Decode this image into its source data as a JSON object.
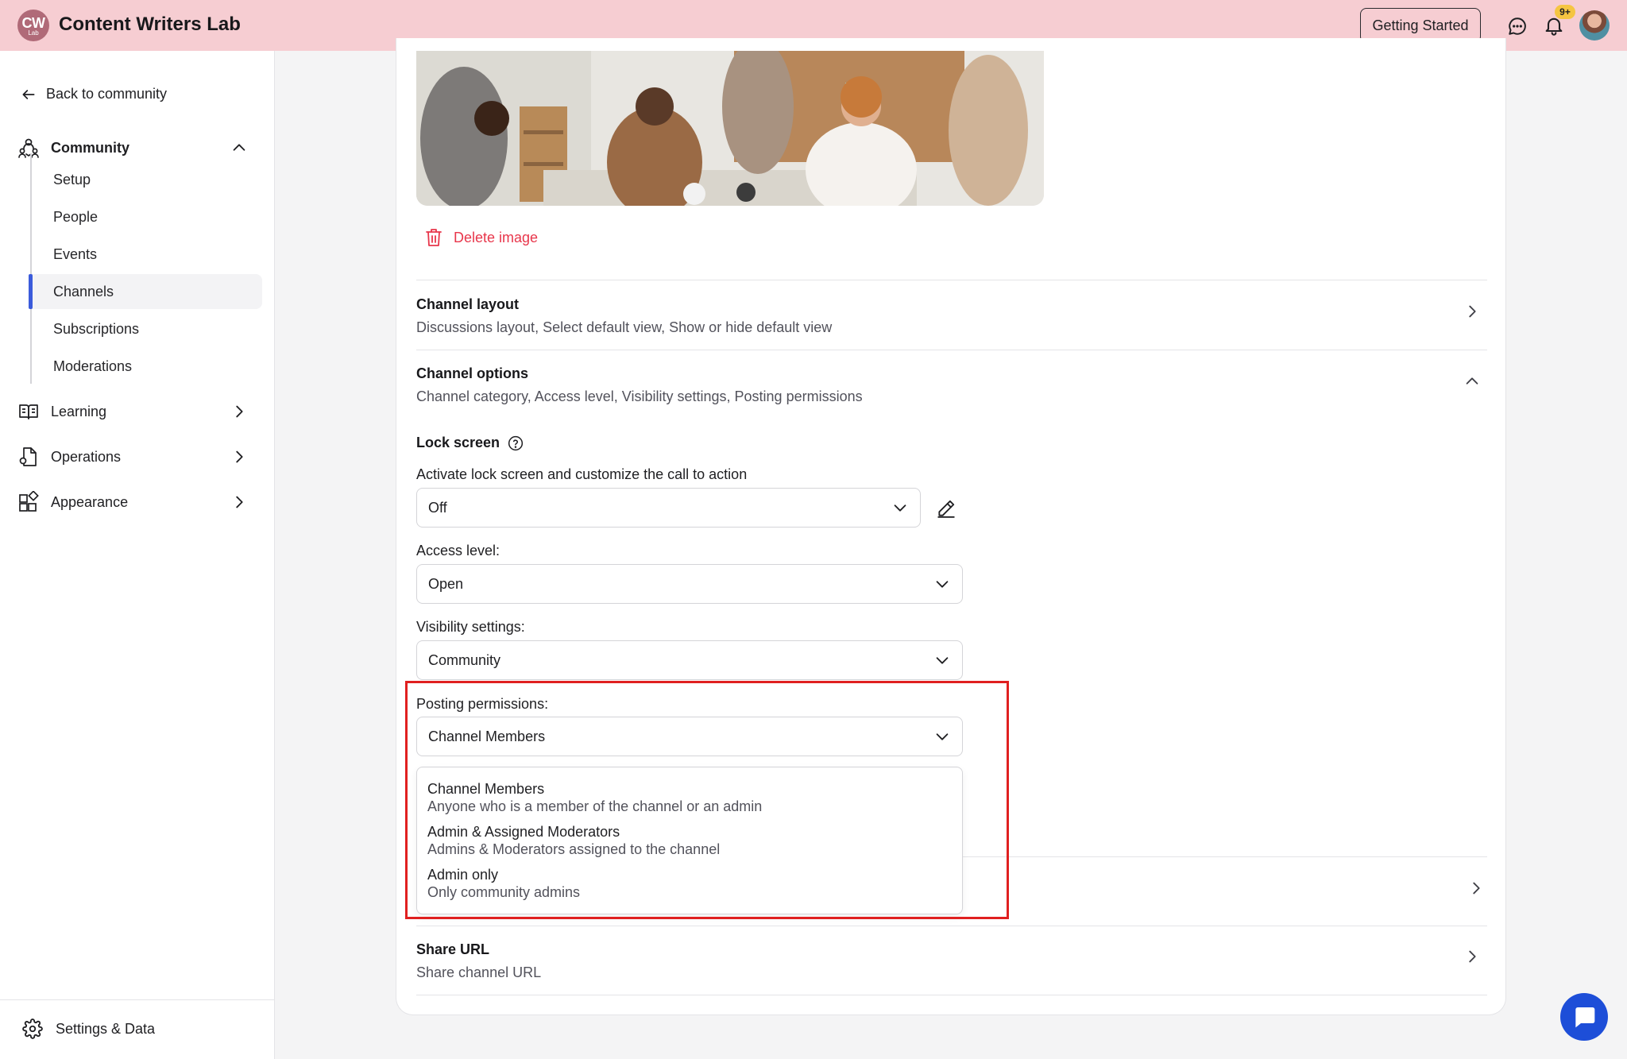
{
  "topbar": {
    "logo_top": "CW",
    "logo_bottom": "Lab",
    "app_title": "Content Writers Lab",
    "getting_started": "Getting Started",
    "notification_count": "9+"
  },
  "sidebar": {
    "back": "Back to community",
    "community": "Community",
    "sub_items": [
      "Setup",
      "People",
      "Events",
      "Channels",
      "Subscriptions",
      "Moderations"
    ],
    "active_sub_item": "Channels",
    "learning": "Learning",
    "operations": "Operations",
    "appearance": "Appearance",
    "settings": "Settings & Data"
  },
  "main": {
    "delete_image": "Delete image",
    "channel_layout": {
      "title": "Channel layout",
      "desc": "Discussions layout, Select default view, Show or hide default view"
    },
    "channel_options": {
      "title": "Channel options",
      "desc": "Channel category, Access level, Visibility settings, Posting permissions"
    },
    "lock_screen": {
      "title": "Lock screen",
      "label": "Activate lock screen and customize the call to action",
      "value": "Off"
    },
    "access_level": {
      "label": "Access level:",
      "value": "Open"
    },
    "visibility": {
      "label": "Visibility settings:",
      "value": "Community"
    },
    "posting_permissions": {
      "label": "Posting permissions:",
      "value": "Channel Members",
      "options": [
        {
          "title": "Channel Members",
          "desc": "Anyone who is a member of the channel or an admin"
        },
        {
          "title": "Admin & Assigned Moderators",
          "desc": "Admins & Moderators assigned to the channel"
        },
        {
          "title": "Admin only",
          "desc": "Only community admins"
        }
      ]
    },
    "share_url": {
      "title": "Share URL",
      "desc": "Share channel URL"
    }
  },
  "colors": {
    "topbar_bg": "#f6cdd2",
    "accent": "#3b5bdb",
    "danger": "#e8364b",
    "highlight": "#e02020",
    "fab": "#1d4ed8"
  }
}
